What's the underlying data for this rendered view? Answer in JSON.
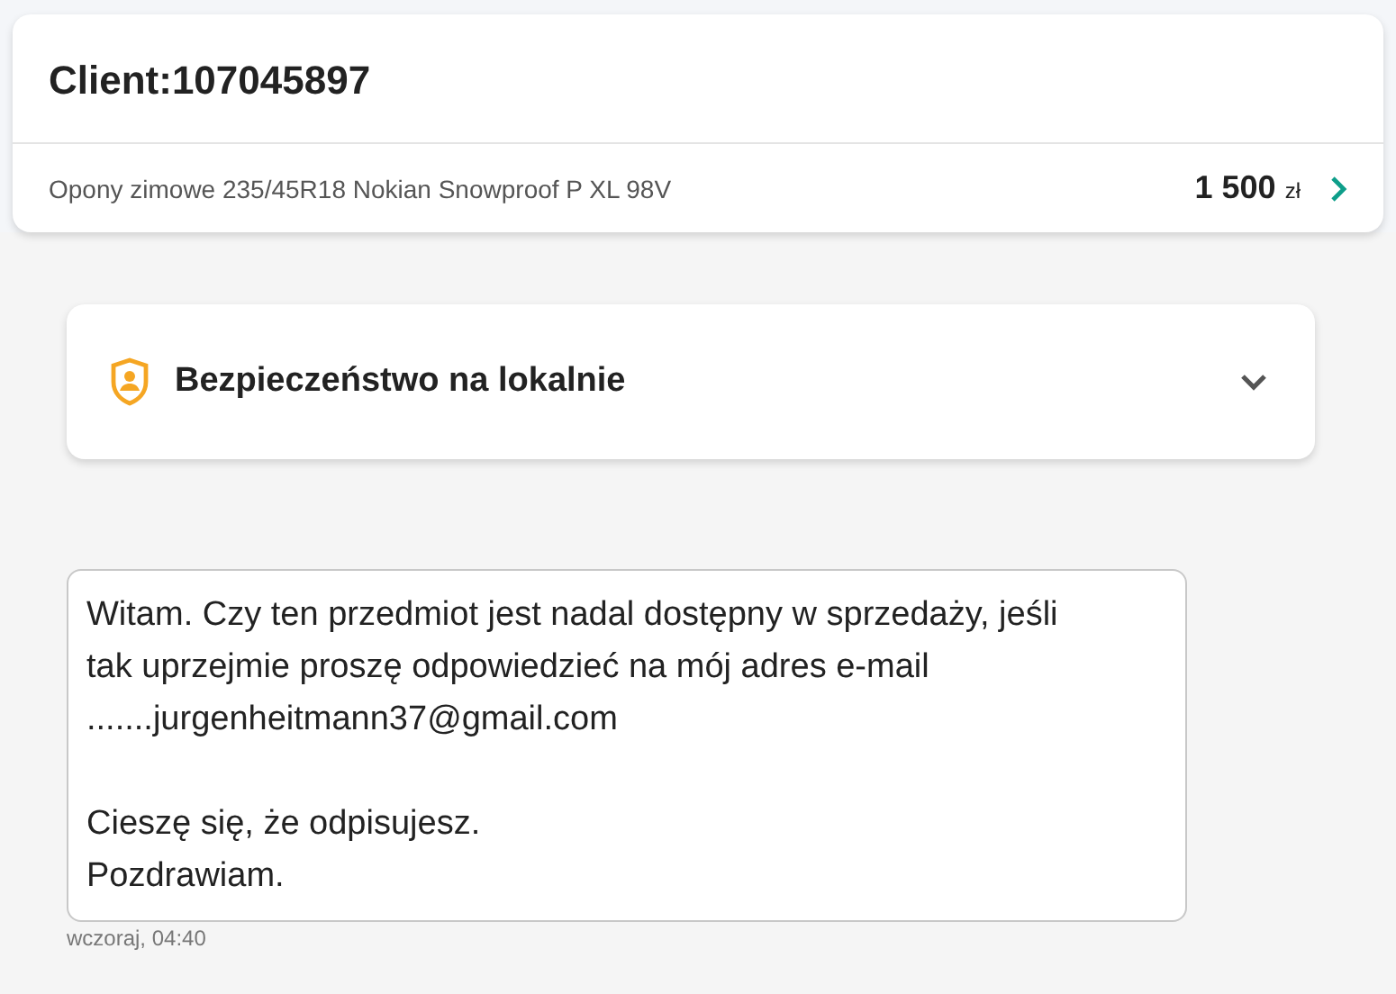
{
  "header": {
    "title": "Client:107045897",
    "listing": {
      "title": "Opony zimowe 235/45R18 Nokian Snowproof P XL 98V",
      "price": "1 500",
      "currency": "zł"
    }
  },
  "safety_panel": {
    "title": "Bezpieczeństwo na lokalnie",
    "expanded": false
  },
  "message": {
    "paragraphs": [
      [
        "Witam. Czy ten przedmiot jest nadal dostępny w sprzedaży, jeśli",
        "tak uprzejmie proszę odpowiedzieć na mój adres e-mail",
        ".......jurgenheitmann37@gmail.com"
      ],
      [
        "Cieszę się, że odpisujesz.",
        "Pozdrawiam."
      ]
    ],
    "time": "wczoraj, 04:40"
  }
}
